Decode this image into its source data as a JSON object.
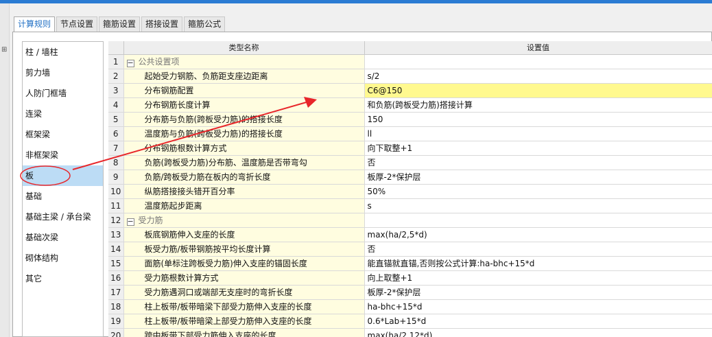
{
  "tabs": [
    {
      "label": "计算规则",
      "active": true
    },
    {
      "label": "节点设置",
      "active": false
    },
    {
      "label": "箍筋设置",
      "active": false
    },
    {
      "label": "搭接设置",
      "active": false
    },
    {
      "label": "箍筋公式",
      "active": false
    }
  ],
  "sidebar": {
    "items": [
      {
        "label": "柱 / 墙柱"
      },
      {
        "label": "剪力墙"
      },
      {
        "label": "人防门框墙"
      },
      {
        "label": "连梁"
      },
      {
        "label": "框架梁"
      },
      {
        "label": "非框架梁"
      },
      {
        "label": "板",
        "selected": true
      },
      {
        "label": "基础"
      },
      {
        "label": "基础主梁 / 承台梁"
      },
      {
        "label": "基础次梁"
      },
      {
        "label": "砌体结构"
      },
      {
        "label": "其它"
      }
    ]
  },
  "table": {
    "headers": {
      "name": "类型名称",
      "value": "设置值"
    },
    "rows": [
      {
        "num": "1",
        "name": "公共设置项",
        "value": "",
        "group": true
      },
      {
        "num": "2",
        "name": "起始受力钢筋、负筋距支座边距离",
        "value": "s/2"
      },
      {
        "num": "3",
        "name": "分布钢筋配置",
        "value": "C6@150",
        "highlight": true
      },
      {
        "num": "4",
        "name": "分布钢筋长度计算",
        "value": "和负筋(跨板受力筋)搭接计算"
      },
      {
        "num": "5",
        "name": "分布筋与负筋(跨板受力筋)的搭接长度",
        "value": "150"
      },
      {
        "num": "6",
        "name": "温度筋与负筋(跨板受力筋)的搭接长度",
        "value": "ll"
      },
      {
        "num": "7",
        "name": "分布钢筋根数计算方式",
        "value": "向下取整+1"
      },
      {
        "num": "8",
        "name": "负筋(跨板受力筋)分布筋、温度筋是否带弯勾",
        "value": "否"
      },
      {
        "num": "9",
        "name": "负筋/跨板受力筋在板内的弯折长度",
        "value": "板厚-2*保护层"
      },
      {
        "num": "10",
        "name": "纵筋搭接接头错开百分率",
        "value": "50%"
      },
      {
        "num": "11",
        "name": "温度筋起步距离",
        "value": "s"
      },
      {
        "num": "12",
        "name": "受力筋",
        "value": "",
        "group": true
      },
      {
        "num": "13",
        "name": "板底钢筋伸入支座的长度",
        "value": "max(ha/2,5*d)"
      },
      {
        "num": "14",
        "name": "板受力筋/板带钢筋按平均长度计算",
        "value": "否"
      },
      {
        "num": "15",
        "name": "面筋(单标注跨板受力筋)伸入支座的锚固长度",
        "value": "能直锚就直锚,否则按公式计算:ha-bhc+15*d"
      },
      {
        "num": "16",
        "name": "受力筋根数计算方式",
        "value": "向上取整+1"
      },
      {
        "num": "17",
        "name": "受力筋遇洞口或端部无支座时的弯折长度",
        "value": "板厚-2*保护层"
      },
      {
        "num": "18",
        "name": "柱上板带/板带暗梁下部受力筋伸入支座的长度",
        "value": "ha-bhc+15*d"
      },
      {
        "num": "19",
        "name": "柱上板带/板带暗梁上部受力筋伸入支座的长度",
        "value": "0.6*Lab+15*d"
      },
      {
        "num": "20",
        "name": "跨中板带下部受力筋伸入支座的长度",
        "value": "max(ha/2,12*d)"
      }
    ]
  },
  "annotation": {
    "color": "#e8262a"
  },
  "colors": {
    "accent": "#1f6fc4",
    "selected": "#bcdcf5",
    "name_bg": "#fffde0",
    "highlight": "#fff98f"
  }
}
